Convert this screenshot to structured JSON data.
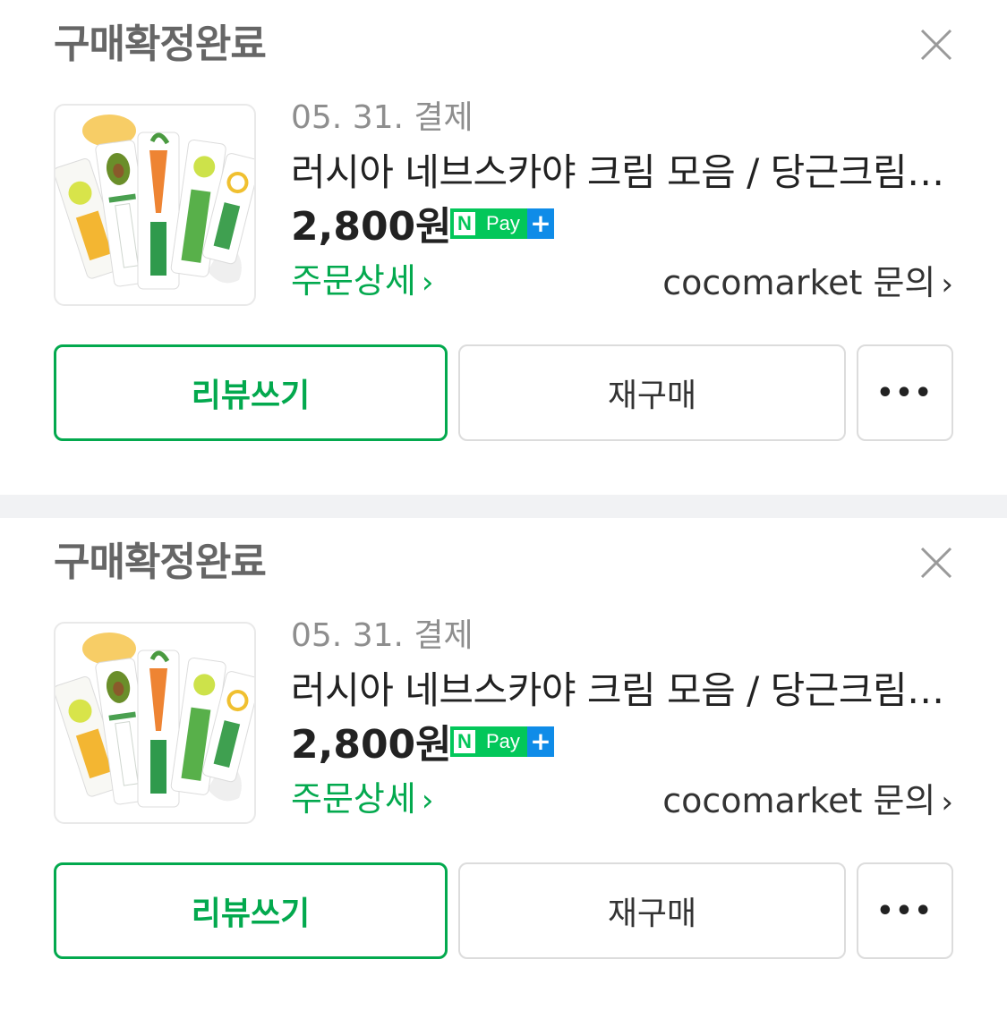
{
  "orders": [
    {
      "status": "구매확정완료",
      "date": "05. 31. 결제",
      "title": "러시아 네브스카야 크림 모음 / 당근크림 아보카도",
      "price": "2,800원",
      "npay": {
        "n": "N",
        "pay": "Pay",
        "plus": "+"
      },
      "detail_link": "주문상세",
      "seller_link": "cocomarket 문의",
      "buttons": {
        "review": "리뷰쓰기",
        "rebuy": "재구매",
        "more": "•••"
      }
    },
    {
      "status": "구매확정완료",
      "date": "05. 31. 결제",
      "title": "러시아 네브스카야 크림 모음 / 당근크림 아보카도",
      "price": "2,800원",
      "npay": {
        "n": "N",
        "pay": "Pay",
        "plus": "+"
      },
      "detail_link": "주문상세",
      "seller_link": "cocomarket 문의",
      "buttons": {
        "review": "리뷰쓰기",
        "rebuy": "재구매",
        "more": "•••"
      }
    }
  ],
  "icons": {
    "close": "close-icon",
    "chevron": "chevron-right-icon",
    "product": "product-thumbnail"
  },
  "colors": {
    "green": "#03a94e",
    "npay_green": "#03c75a",
    "npay_blue": "#0f8ce8",
    "divider": "#f1f2f4"
  }
}
